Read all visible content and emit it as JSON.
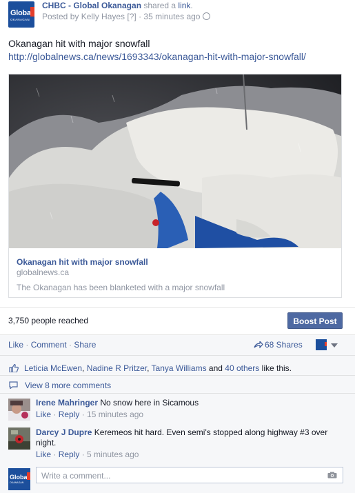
{
  "post": {
    "page_name": "CHBC - Global Okanagan",
    "action_text": " shared a ",
    "action_link": "link",
    "action_end": ".",
    "posted_by_prefix": "Posted by ",
    "poster": "Kelly Hayes",
    "poster_tag": " [?] · ",
    "time": "35 minutes ago",
    "text": "Okanagan hit with major snowfall",
    "url": "http://globalnews.ca/news/1693343/okanagan-hit-with-major-snowfall/",
    "logo_text": "Global",
    "logo_sub": "OKANAGAN"
  },
  "link_card": {
    "title": "Okanagan hit with major snowfall",
    "domain": "globalnews.ca",
    "description": "The Okanagan has been blanketed with a major snowfall"
  },
  "reach": {
    "text": "3,750 people reached",
    "boost_label": "Boost Post"
  },
  "actions": {
    "like": "Like",
    "comment": "Comment",
    "share": "Share",
    "sep": " · ",
    "shares_count": "68 Shares"
  },
  "likes": {
    "names": [
      "Leticia McEwen",
      "Nadine R Pritzer",
      "Tanya Williams"
    ],
    "comma": ", ",
    "and": " and ",
    "others": "40 others",
    "suffix": " like this."
  },
  "view_more": "View 8 more comments",
  "comments": [
    {
      "author": "Irene Mahringer",
      "text": " No snow here in Sicamous",
      "like": "Like",
      "reply": "Reply",
      "time": "15 minutes ago"
    },
    {
      "author": "Darcy J Dupre",
      "text": " Keremeos hit hard. Even semi's stopped along highway #3 over night.",
      "like": "Like",
      "reply": "Reply",
      "time": "5 minutes ago"
    }
  ],
  "write_comment": {
    "placeholder": "Write a comment..."
  },
  "colors": {
    "link": "#3b5998",
    "brand": "#1c4f9c",
    "boost": "#4e69a2",
    "muted": "#9197a3"
  }
}
